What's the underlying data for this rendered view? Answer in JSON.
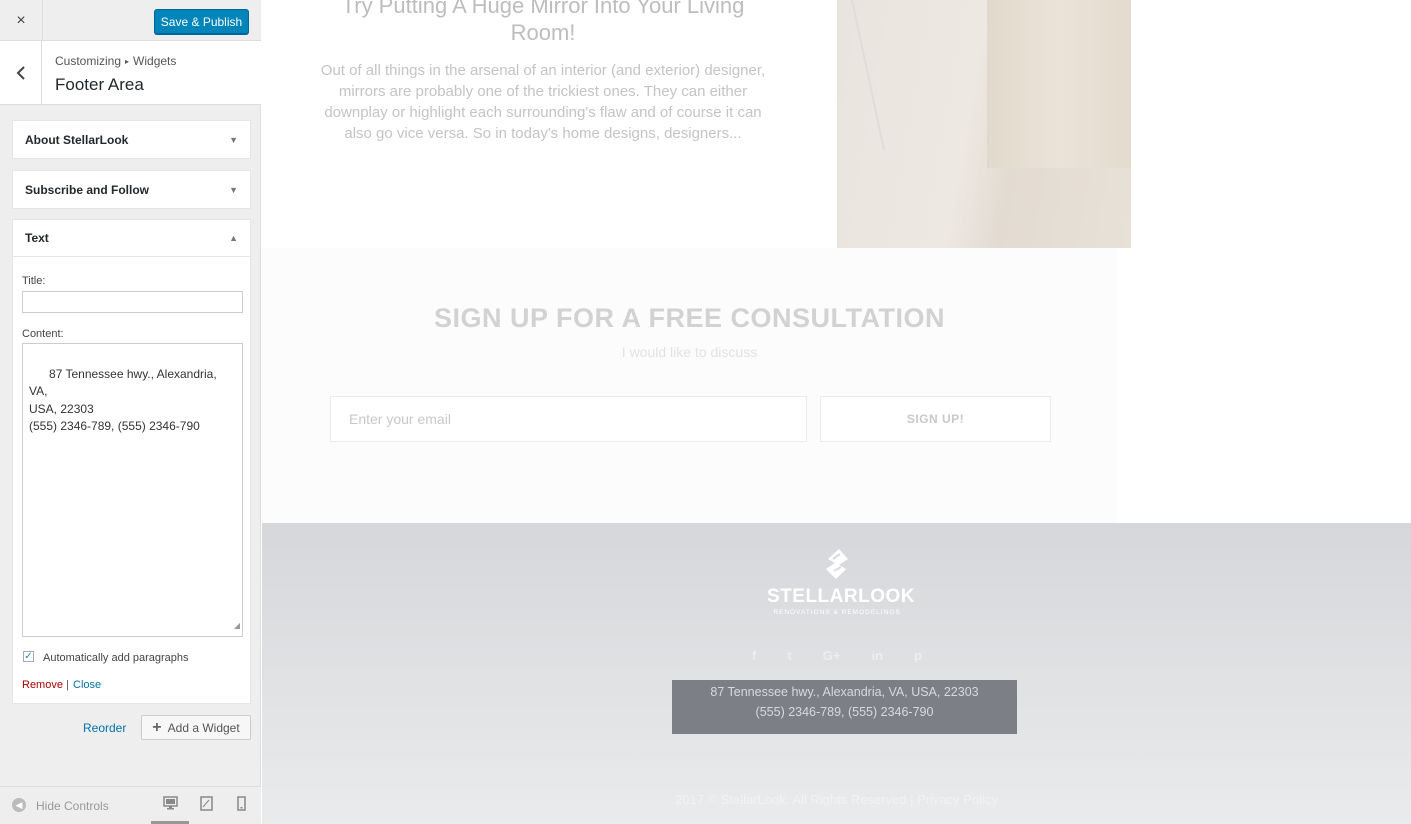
{
  "topbar": {
    "close_icon": "×",
    "save_label": "Save & Publish"
  },
  "section": {
    "back_icon": "‹",
    "breadcrumb_root": "Customizing",
    "breadcrumb_sep": "▸",
    "breadcrumb_child": "Widgets",
    "title": "Footer Area"
  },
  "widgets": [
    {
      "title": "About StellarLook",
      "arrow": "▼"
    },
    {
      "title": "Subscribe and Follow",
      "arrow": "▼"
    },
    {
      "title": "Text",
      "arrow": "▲"
    }
  ],
  "text_widget": {
    "title_label": "Title:",
    "title_value": "",
    "content_label": "Content:",
    "content_value": "87 Tennessee hwy., Alexandria, VA,\nUSA, 22303\n(555) 2346-789, (555) 2346-790",
    "auto_paragraphs_label": "Automatically add paragraphs",
    "auto_paragraphs_checked": true,
    "remove_label": "Remove",
    "separator": "|",
    "close_label": "Close"
  },
  "panel_actions": {
    "reorder_label": "Reorder",
    "add_widget_label": "Add a Widget"
  },
  "footer_controls": {
    "hide_label": "Hide Controls",
    "devices": [
      "desktop",
      "tablet",
      "mobile"
    ],
    "active_device": "desktop"
  },
  "preview": {
    "post_title": "Try Putting A Huge Mirror Into Your Living Room!",
    "post_excerpt": "Out of all things in the arsenal of an interior (and exterior) designer, mirrors are probably one of the trickiest ones. They can either downplay or highlight each surrounding's flaw and of course it can also go vice versa. So in today's home designs, designers...",
    "signup_heading": "SIGN UP FOR A FREE CONSULTATION",
    "signup_sub": "I would like to discuss",
    "email_placeholder": "Enter your email",
    "signup_button": "SIGN UP!",
    "brand_name": "STELLARLOOK",
    "brand_tagline": "RENOVATIONS & REMODELINGS",
    "social": [
      "f",
      "t",
      "G+",
      "in",
      "p"
    ],
    "address_line1": "87 Tennessee hwy., Alexandria, VA, USA, 22303",
    "address_line2": "(555) 2346-789, (555) 2346-790",
    "copyright": "2017 © StellarLook. All Rights Reserved | Privacy Policy"
  }
}
